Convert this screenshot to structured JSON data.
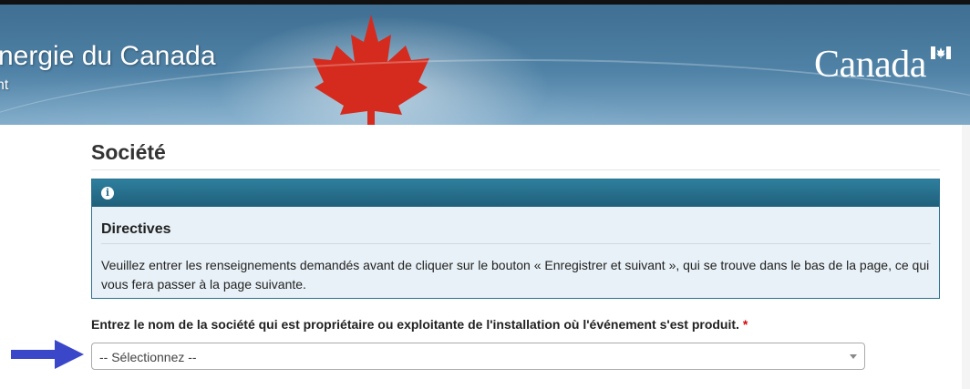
{
  "header": {
    "title": "nergie du Canada",
    "subtitle": "nt",
    "wordmark": "Canad",
    "wordmark_end": "a"
  },
  "main": {
    "page_title": "Société",
    "notice": {
      "icon": "info-icon",
      "title": "Directives",
      "body": "Veuillez entrer les renseignements demandés avant de cliquer sur le bouton « Enregistrer et suivant », qui se trouve dans le bas de la page, ce qui vous fera passer à la page suivante."
    },
    "company_field": {
      "label": "Entrez le nom de la société qui est propriétaire ou exploitante de l'installation où l'événement s'est produit.",
      "required_marker": "*",
      "selected_value": "-- Sélectionnez --"
    }
  },
  "colors": {
    "banner": "#4f82a6",
    "notice_header": "#2b7291",
    "notice_background": "#e8f1f7",
    "required": "#d3080c",
    "arrow": "#3b47c9",
    "maple_leaf": "#d52b1e"
  }
}
